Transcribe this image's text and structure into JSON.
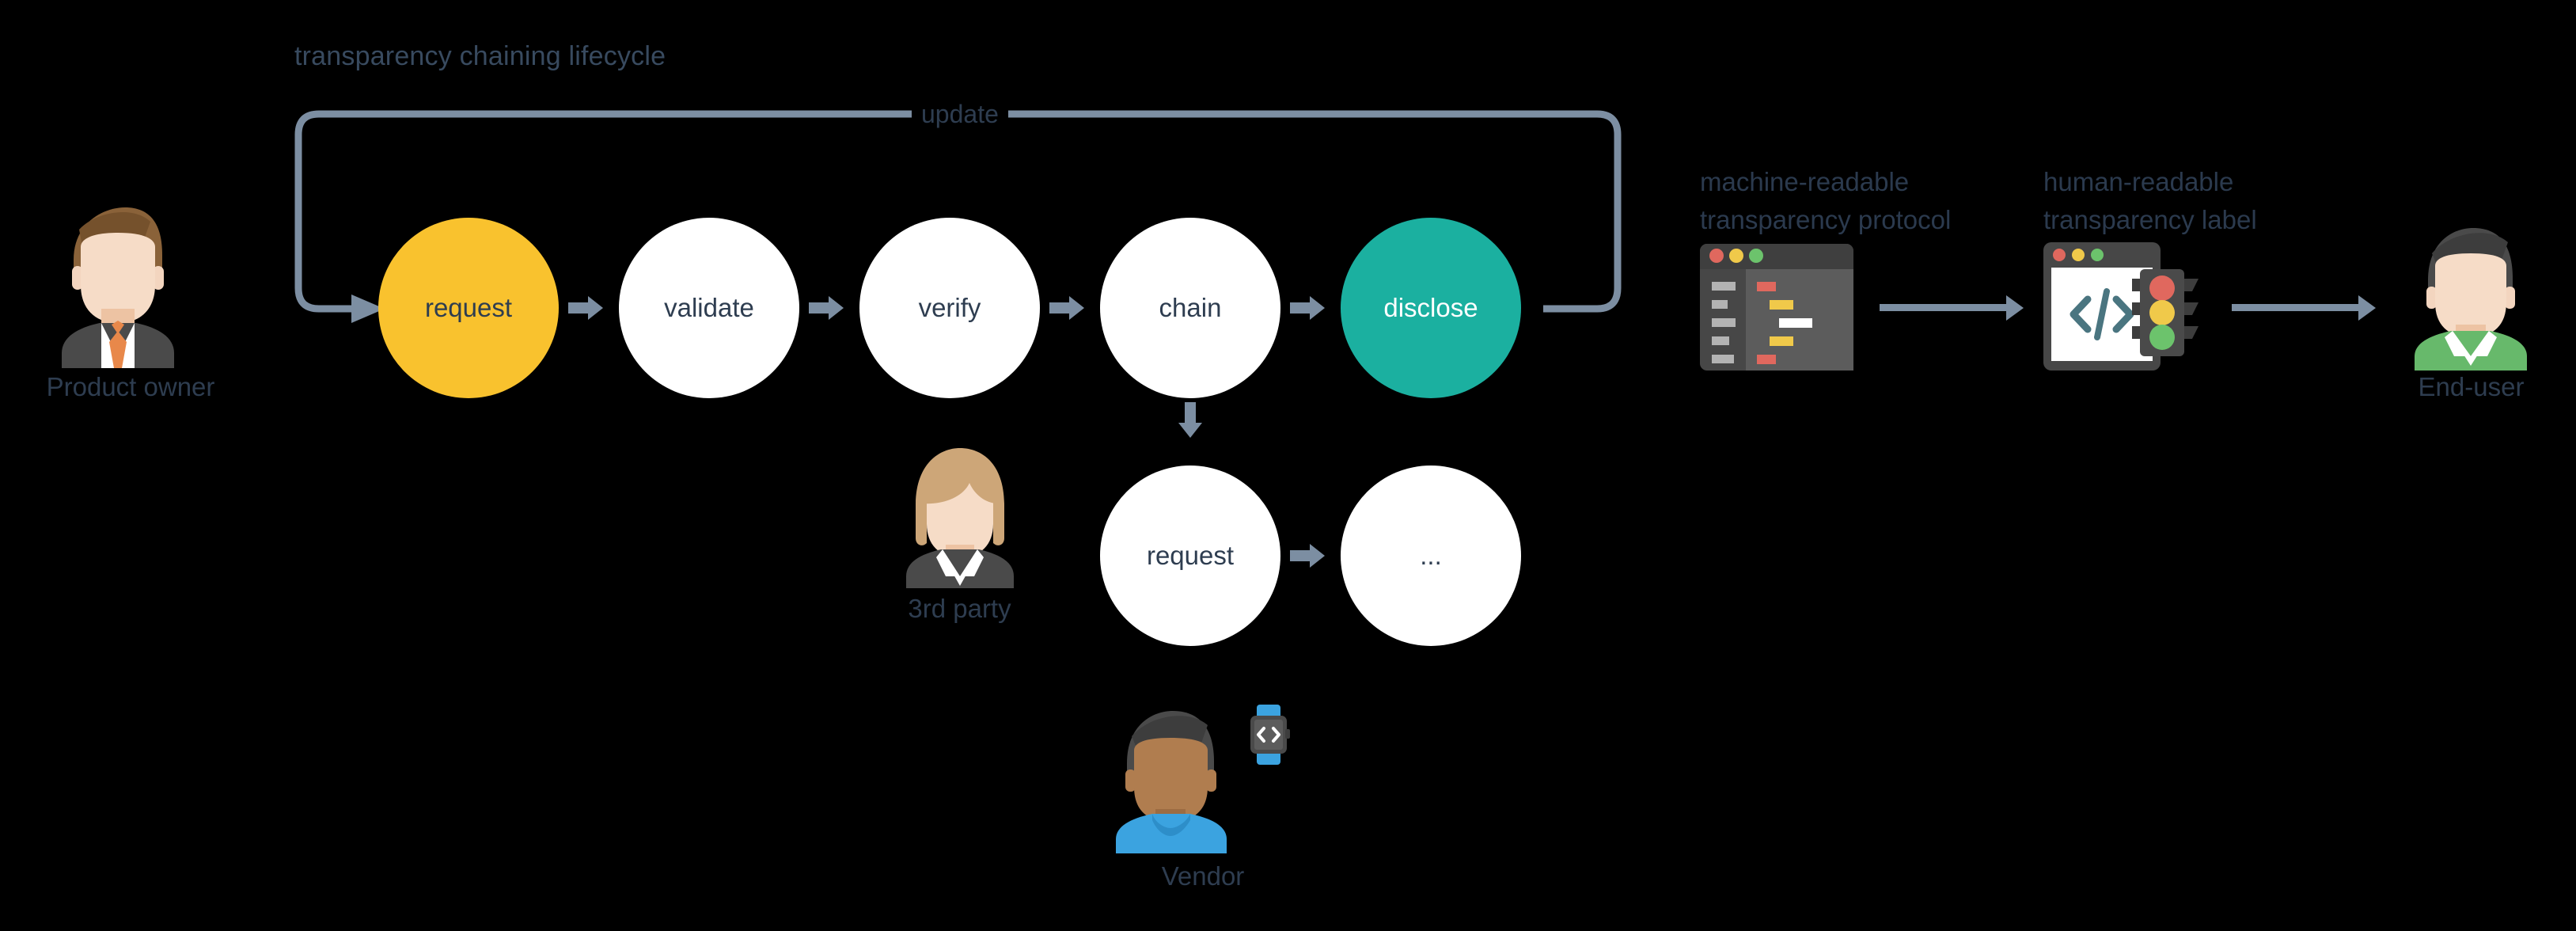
{
  "diagram": {
    "title": "transparency chaining lifecycle",
    "background_color": "#000000",
    "text_color": "#2e3d50",
    "arrow_color": "#7c8ea2"
  },
  "loop": {
    "label": "update"
  },
  "actors": {
    "product_owner": {
      "label": "Product owner",
      "shirt_color": "#4a4a4a",
      "hair_color": "#8a6239",
      "tie_color": "#e8884a"
    },
    "third_party": {
      "label": "3rd party",
      "shirt_color": "#4a4a4a",
      "hair_color": "#cda678"
    },
    "vendor": {
      "label": "Vendor",
      "shirt_color": "#3ba3e0",
      "hair_color": "#4a4a4a",
      "skin_color": "#b07d4f"
    },
    "end_user": {
      "label": "End-user",
      "shirt_color": "#67b96b",
      "hair_color": "#4a4a4a"
    }
  },
  "main_flow": {
    "nodes": [
      {
        "label": "request",
        "fill": "#f9c22e",
        "text": "#2e3d50"
      },
      {
        "label": "validate",
        "fill": "#ffffff",
        "text": "#2e3d50"
      },
      {
        "label": "verify",
        "fill": "#ffffff",
        "text": "#2e3d50"
      },
      {
        "label": "chain",
        "fill": "#ffffff",
        "text": "#2e3d50"
      },
      {
        "label": "disclose",
        "fill": "#1bb0a0",
        "text": "#ffffff"
      }
    ]
  },
  "sub_flow": {
    "nodes": [
      {
        "label": "request",
        "fill": "#ffffff",
        "text": "#2e3d50"
      },
      {
        "label": "...",
        "fill": "#ffffff",
        "text": "#2e3d50"
      }
    ]
  },
  "outputs": {
    "protocol": {
      "caption_line1": "machine-readable",
      "caption_line2": "transparency protocol",
      "icon": "code-window-icon"
    },
    "label": {
      "caption_line1": "human-readable",
      "caption_line2": "transparency label",
      "icon": "code-traffic-light-icon"
    }
  },
  "palette": {
    "yellow": "#f9c22e",
    "teal": "#1bb0a0",
    "slate": "#7c8ea2",
    "navy": "#2e3d50",
    "red_dot": "#e0685e",
    "yellow_dot": "#f0c94a",
    "green_dot": "#6cc36c",
    "window_dark": "#474747",
    "window_mid": "#5c5c5c"
  }
}
